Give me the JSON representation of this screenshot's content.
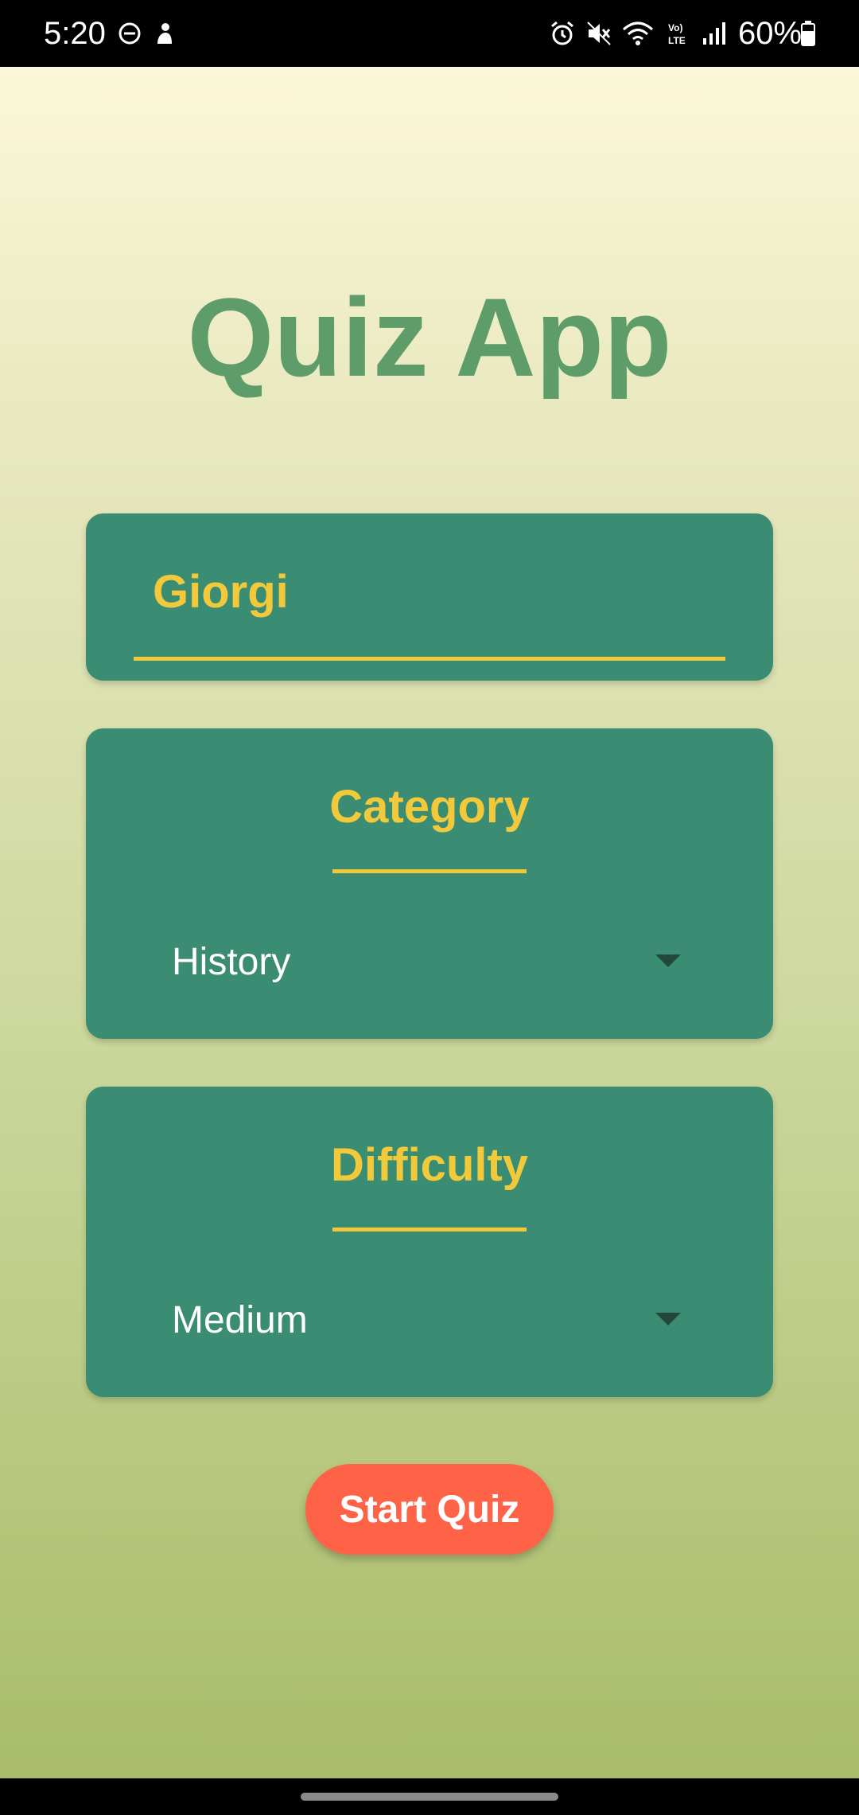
{
  "status_bar": {
    "time": "5:20",
    "battery_text": "60%",
    "icons": [
      "do-not-disturb-icon",
      "notification-icon",
      "alarm-icon",
      "mute-icon",
      "wifi-icon",
      "volte-icon",
      "signal-icon",
      "battery-icon"
    ]
  },
  "app": {
    "title": "Quiz App"
  },
  "name_field": {
    "value": "Giorgi"
  },
  "category": {
    "label": "Category",
    "selected": "History"
  },
  "difficulty": {
    "label": "Difficulty",
    "selected": "Medium"
  },
  "start_button": {
    "label": "Start Quiz"
  },
  "colors": {
    "title": "#5e9d6a",
    "card": "#3a8c72",
    "accent": "#f3c93c",
    "button": "#ff6347"
  }
}
